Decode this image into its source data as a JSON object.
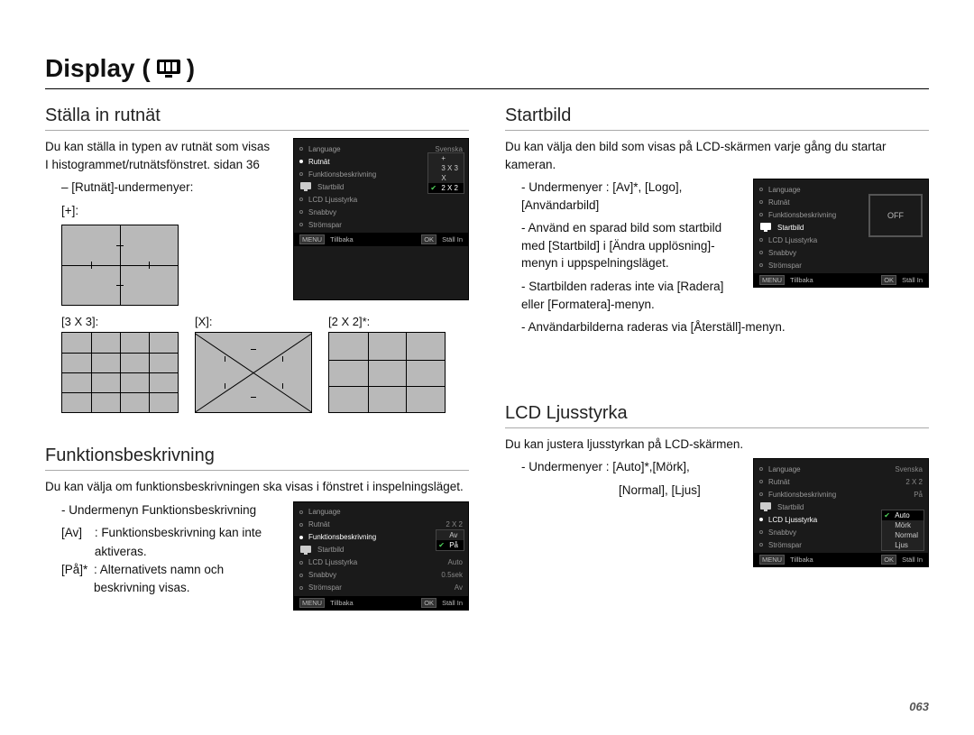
{
  "page_title_prefix": "Display (",
  "page_title_suffix": " )",
  "page_number": "063",
  "grid_section": {
    "heading": "Ställa in rutnät",
    "intro": "Du kan ställa in typen av rutnät som visas I histogrammet/rutnätsfönstret. sidan 36",
    "submenu_label": "– [Rutnät]-undermenyer:",
    "plus_label": "[+]:",
    "g33_label": "[3 X 3]:",
    "x_label": "[X]:",
    "g22_label": "[2 X 2]*:"
  },
  "func_section": {
    "heading": "Funktionsbeskrivning",
    "intro": "Du kan välja om funktionsbeskrivningen ska visas i fönstret i inspelningsläget.",
    "line1": "- Undermenyn Funktionsbeskrivning",
    "av_key": "[Av]",
    "av_val": ": Funktionsbeskrivning kan inte aktiveras.",
    "pa_key": "[På]*",
    "pa_val": ": Alternativets namn och beskrivning visas."
  },
  "start_section": {
    "heading": "Startbild",
    "intro": "Du kan välja den bild som visas på LCD-skärmen varje gång du startar kameran.",
    "b1": "- Undermenyer : [Av]*, [Logo], [Användarbild]",
    "b2": "- Använd en sparad bild som startbild med [Startbild] i [Ändra upplösning]-menyn i uppspelningsläget.",
    "b3": "- Startbilden raderas inte via [Radera] eller [Formatera]-menyn.",
    "b4": "- Användarbilderna raderas via [Återställ]-menyn."
  },
  "lcd_section": {
    "heading": "LCD Ljusstyrka",
    "intro": "Du kan justera ljusstyrkan på LCD-skärmen.",
    "b1a": "- Undermenyer : [Auto]*,[Mörk],",
    "b1b": "[Normal], [Ljus]"
  },
  "osd_common": {
    "items": [
      "Language",
      "Rutnät",
      "Funktionsbeskrivning",
      "Startbild",
      "LCD Ljusstyrka",
      "Snabbvy",
      "Strömspar"
    ],
    "footer_back_tag": "MENU",
    "footer_back": "Tillbaka",
    "footer_ok_tag": "OK",
    "footer_ok": "Ställ In"
  },
  "osd_grid": {
    "val_lang": "Svenska",
    "popup": [
      "+",
      "3 X 3",
      "X",
      "2 X 2"
    ],
    "popup_selected": "2 X 2"
  },
  "osd_func": {
    "val_rutnat": "2 X 2",
    "popup": [
      "Av",
      "På"
    ],
    "popup_selected": "På",
    "val_lcd": "Auto",
    "val_snabb": "0.5sek",
    "val_strom": "Av"
  },
  "osd_start": {
    "preview_text": "OFF"
  },
  "osd_lcd": {
    "val_lang": "Svenska",
    "val_rutnat": "2 X 2",
    "val_func": "På",
    "popup": [
      "Auto",
      "Mörk",
      "Normal",
      "Ljus"
    ],
    "popup_selected": "Auto"
  }
}
